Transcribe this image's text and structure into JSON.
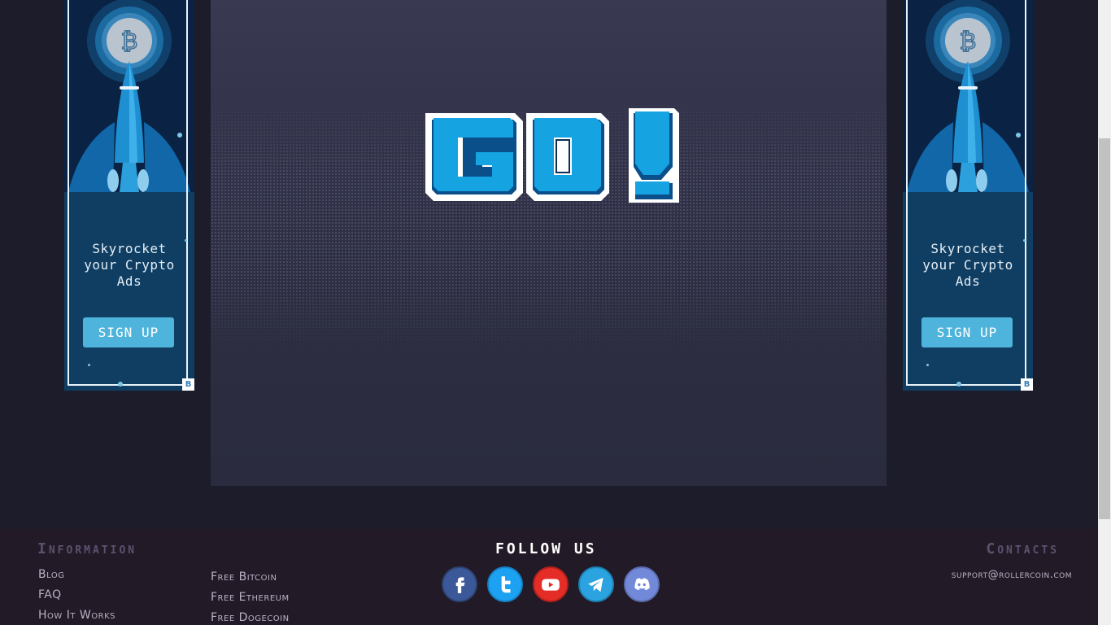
{
  "ads": {
    "left": {
      "line1": "Skyrocket",
      "line2": "your Crypto",
      "line3": "Ads",
      "button_label": "SIGN UP",
      "badge": "B"
    },
    "right": {
      "line1": "Skyrocket",
      "line2": "your Crypto",
      "line3": "Ads",
      "button_label": "SIGN UP",
      "badge": "B"
    }
  },
  "game": {
    "message": "GO!"
  },
  "footer": {
    "information": {
      "heading": "Information",
      "links": [
        "Blog",
        "FAQ",
        "How It Works"
      ]
    },
    "free_links": [
      "Free Bitcoin",
      "Free Ethereum",
      "Free Dogecoin"
    ],
    "follow": {
      "heading": "FOLLOW US",
      "icons": [
        "facebook-icon",
        "twitter-icon",
        "youtube-icon",
        "telegram-icon",
        "discord-icon"
      ]
    },
    "contacts": {
      "heading": "Contacts",
      "email": "support@rollercoin.com"
    }
  },
  "colors": {
    "background": "#1c1c2a",
    "game_panel": "#33344b",
    "footer": "#221a26",
    "accent_blue": "#1fa9e6",
    "ad_button": "#4fb4dc"
  }
}
